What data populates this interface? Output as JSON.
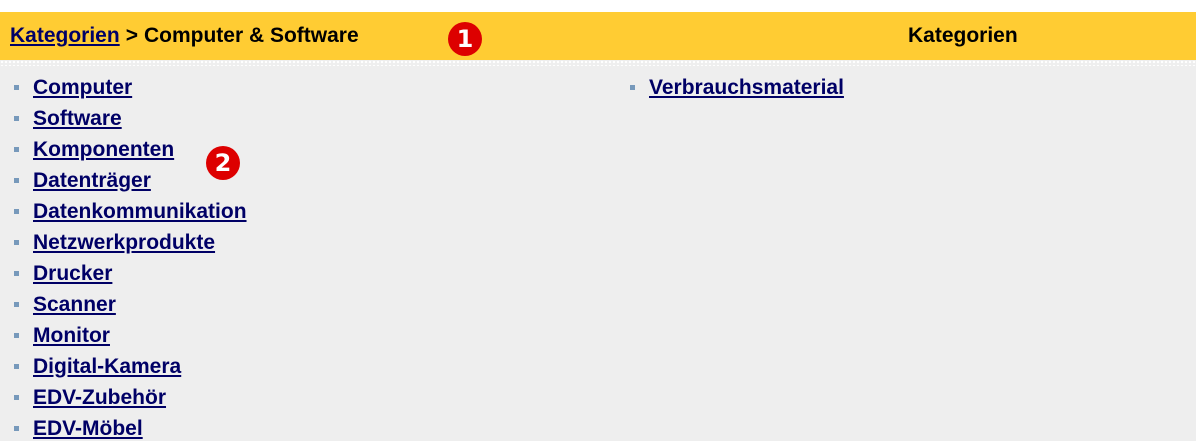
{
  "header": {
    "breadcrumb_link": "Kategorien",
    "breadcrumb_separator": ">",
    "breadcrumb_current": "Computer & Software",
    "right_title": "Kategorien",
    "background_color": "#ffcc33"
  },
  "annotations": {
    "marker_1": "1",
    "marker_2": "2",
    "marker_color": "#dd0000"
  },
  "categories": {
    "left": [
      "Computer",
      "Software",
      "Komponenten",
      "Datenträger",
      "Datenkommunikation",
      "Netzwerkprodukte",
      "Drucker",
      "Scanner",
      "Monitor",
      "Digital-Kamera",
      "EDV-Zubehör",
      "EDV-Möbel"
    ],
    "right": [
      "Verbrauchsmaterial"
    ],
    "link_color": "#000066",
    "bullet_icon": "square-bullet-icon"
  }
}
